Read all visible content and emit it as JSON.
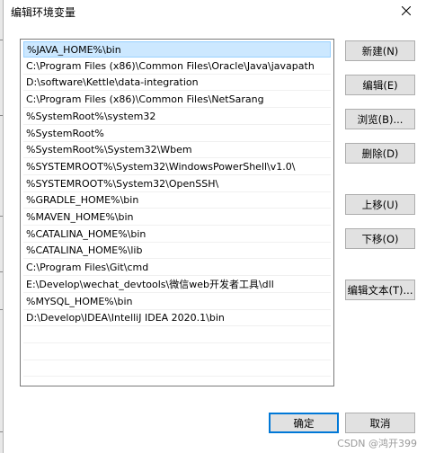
{
  "window": {
    "title": "编辑环境变量"
  },
  "paths": [
    "%JAVA_HOME%\\bin",
    "C:\\Program Files (x86)\\Common Files\\Oracle\\Java\\javapath",
    "D:\\software\\Kettle\\data-integration",
    "C:\\Program Files (x86)\\Common Files\\NetSarang",
    "%SystemRoot%\\system32",
    "%SystemRoot%",
    "%SystemRoot%\\System32\\Wbem",
    "%SYSTEMROOT%\\System32\\WindowsPowerShell\\v1.0\\",
    "%SYSTEMROOT%\\System32\\OpenSSH\\",
    "%GRADLE_HOME%\\bin",
    "%MAVEN_HOME%\\bin",
    "%CATALINA_HOME%\\bin",
    "%CATALINA_HOME%\\lib",
    "C:\\Program Files\\Git\\cmd",
    "E:\\Develop\\wechat_devtools\\微信web开发者工具\\dll",
    "%MYSQL_HOME%\\bin",
    "D:\\Develop\\IDEA\\IntelliJ IDEA 2020.1\\bin"
  ],
  "selected_index": 0,
  "buttons": {
    "new": "新建(N)",
    "edit": "编辑(E)",
    "browse": "浏览(B)...",
    "delete": "删除(D)",
    "move_up": "上移(U)",
    "move_down": "下移(O)",
    "edit_text": "编辑文本(T)...",
    "ok": "确定",
    "cancel": "取消"
  },
  "watermark": "CSDN @鸿开399"
}
